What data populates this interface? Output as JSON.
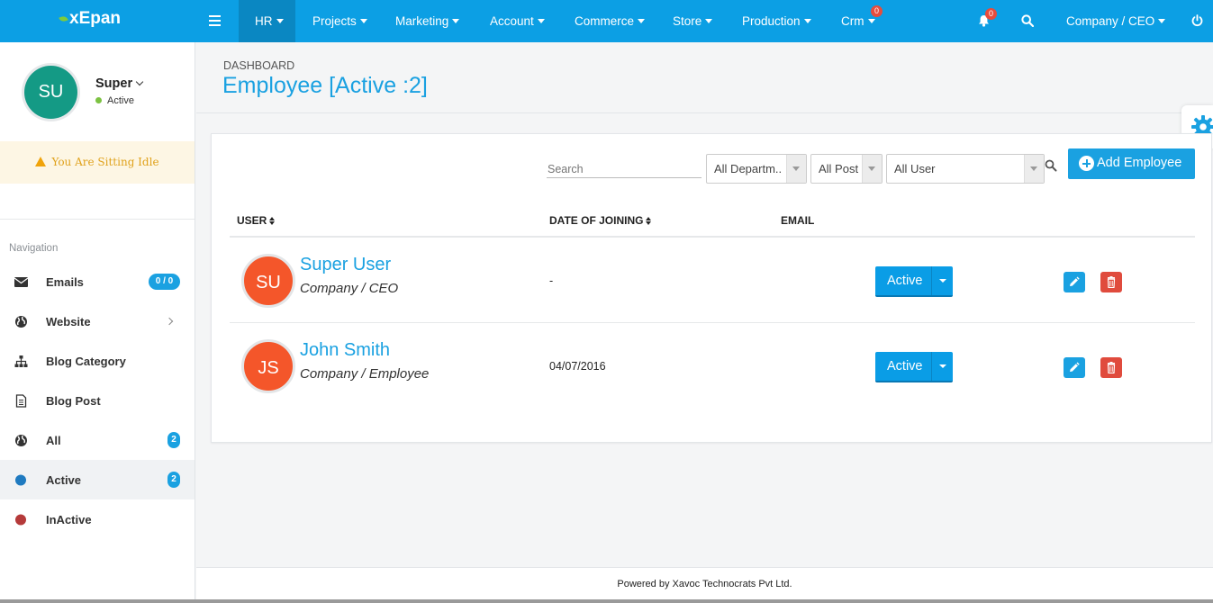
{
  "brand": {
    "name": "xEpan",
    "leaf_color": "#7ecb3b"
  },
  "topnav": {
    "menu_icon": "hamburger-icon",
    "items": [
      {
        "label": "HR"
      },
      {
        "label": "Projects"
      },
      {
        "label": "Marketing"
      },
      {
        "label": "Account"
      },
      {
        "label": "Commerce"
      },
      {
        "label": "Store"
      },
      {
        "label": "Production"
      },
      {
        "label": "Crm",
        "badge": "0"
      }
    ],
    "notification_badge": "0",
    "user_role": "Company / CEO",
    "accent": "#0c9fe4"
  },
  "sidebar": {
    "avatar_initials": "SU",
    "user_name": "Super",
    "user_status": "Active",
    "idle_message": "You Are Sitting Idle",
    "nav_heading": "Navigation",
    "items": [
      {
        "label": "Emails",
        "icon": "envelope-icon",
        "badge": "0 / 0"
      },
      {
        "label": "Website",
        "icon": "globe-icon"
      },
      {
        "label": "Blog Category",
        "icon": "sitemap-icon"
      },
      {
        "label": "Blog Post",
        "icon": "document-icon"
      },
      {
        "label": "All",
        "icon": "globe-icon",
        "badge": "2"
      },
      {
        "label": "Active",
        "icon": "blue-dot-icon",
        "badge": "2"
      },
      {
        "label": "InActive",
        "icon": "red-dot-icon"
      }
    ]
  },
  "header": {
    "breadcrumb": "DASHBOARD",
    "title": "Employee [Active :2]"
  },
  "filters": {
    "search_placeholder": "Search",
    "department": "All Departm..",
    "post": "All Post",
    "user": "All User",
    "add_button": "Add Employee"
  },
  "table": {
    "columns": [
      "USER",
      "DATE OF JOINING",
      "EMAIL"
    ],
    "rows": [
      {
        "initials": "SU",
        "name": "Super User",
        "post": "Company / CEO",
        "date": "-",
        "status": "Active"
      },
      {
        "initials": "JS",
        "name": "John Smith",
        "post": "Company / Employee",
        "date": "04/07/2016",
        "status": "Active"
      }
    ]
  },
  "footer": "Powered by Xavoc Technocrats Pvt Ltd."
}
